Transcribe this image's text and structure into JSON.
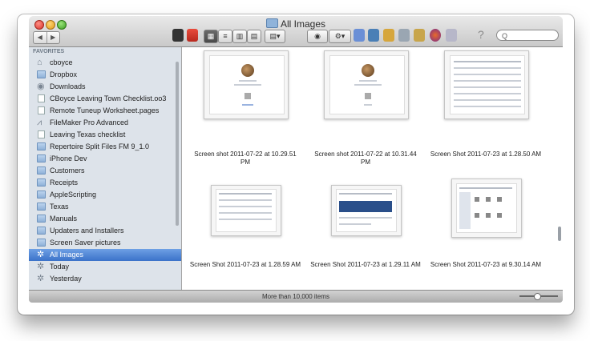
{
  "window": {
    "title": "All Images"
  },
  "toolbar": {
    "back": "◀",
    "forward": "▶",
    "search_placeholder": "Q",
    "help": "?"
  },
  "sidebar": {
    "heading": "FAVORITES",
    "items": [
      {
        "label": "cboyce",
        "icon": "home-icon"
      },
      {
        "label": "Dropbox",
        "icon": "folder-icon"
      },
      {
        "label": "Downloads",
        "icon": "downloads-icon"
      },
      {
        "label": "CBoyce Leaving Town Checklist.oo3",
        "icon": "document-icon"
      },
      {
        "label": "Remote Tuneup Worksheet.pages",
        "icon": "document-icon"
      },
      {
        "label": "FileMaker Pro Advanced",
        "icon": "app-icon"
      },
      {
        "label": "Leaving Texas checklist",
        "icon": "document-icon"
      },
      {
        "label": "Repertoire Split Files FM 9_1.0",
        "icon": "folder-icon"
      },
      {
        "label": "iPhone Dev",
        "icon": "folder-icon"
      },
      {
        "label": "Customers",
        "icon": "folder-icon"
      },
      {
        "label": "Receipts",
        "icon": "folder-icon"
      },
      {
        "label": "AppleScripting",
        "icon": "folder-icon"
      },
      {
        "label": "Texas",
        "icon": "folder-icon"
      },
      {
        "label": "Manuals",
        "icon": "folder-icon"
      },
      {
        "label": "Updaters and Installers",
        "icon": "folder-icon"
      },
      {
        "label": "Screen Saver pictures",
        "icon": "folder-icon"
      },
      {
        "label": "All Images",
        "icon": "smart-folder-icon",
        "selected": true
      },
      {
        "label": "Today",
        "icon": "smart-folder-icon"
      },
      {
        "label": "Yesterday",
        "icon": "smart-folder-icon"
      }
    ]
  },
  "files": [
    {
      "name": "Screen shot 2011-07-22 at 10.29.51 PM"
    },
    {
      "name": "Screen shot 2011-07-22 at 10.31.44 PM"
    },
    {
      "name": "Screen Shot 2011-07-23 at 1.28.50 AM"
    },
    {
      "name": "Screen Shot 2011-07-23 at 1.28.59 AM"
    },
    {
      "name": "Screen Shot 2011-07-23 at 1.29.11 AM"
    },
    {
      "name": "Screen Shot 2011-07-23 at 9.30.14 AM"
    }
  ],
  "status": {
    "text": "More than 10,000 items"
  },
  "colors": {
    "selection": "#3b72c9",
    "sidebar": "#dde3ea"
  }
}
